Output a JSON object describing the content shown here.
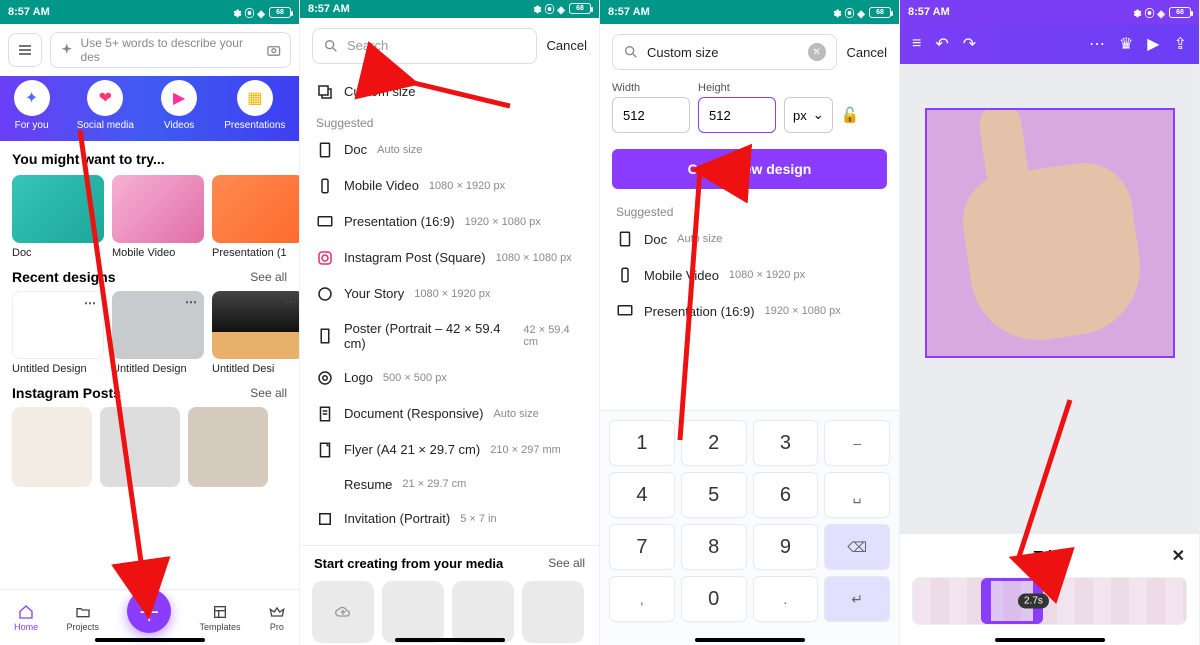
{
  "status": {
    "time": "8:57 AM",
    "battery": "68",
    "icons": "✕ ◁ ✕ ✕"
  },
  "col1": {
    "search_placeholder": "Use 5+ words to describe your des",
    "chips": [
      {
        "label": "For you",
        "glyph": "✦",
        "color": "#4f6ef5"
      },
      {
        "label": "Social media",
        "glyph": "❤",
        "color": "#ff3b6b"
      },
      {
        "label": "Videos",
        "glyph": "▶",
        "color": "#ff2fa0"
      },
      {
        "label": "Presentations",
        "glyph": "▦",
        "color": "#ffb300"
      }
    ],
    "try_heading": "You might want to try...",
    "try_items": [
      {
        "label": "Doc"
      },
      {
        "label": "Mobile Video"
      },
      {
        "label": "Presentation (1"
      }
    ],
    "recent_heading": "Recent designs",
    "see_all": "See all",
    "recent_items": [
      {
        "label": "Untitled Design"
      },
      {
        "label": "Untitled Design"
      },
      {
        "label": "Untitled Desi"
      }
    ],
    "ig_heading": "Instagram Posts",
    "nav": {
      "home": "Home",
      "projects": "Projects",
      "templates": "Templates",
      "pro": "Pro"
    }
  },
  "col2": {
    "search_placeholder": "Search",
    "cancel": "Cancel",
    "custom_size": "Custom size",
    "suggested": "Suggested",
    "items": [
      {
        "name": "Doc",
        "dim": "Auto size"
      },
      {
        "name": "Mobile Video",
        "dim": "1080 × 1920 px"
      },
      {
        "name": "Presentation (16:9)",
        "dim": "1920 × 1080 px"
      },
      {
        "name": "Instagram Post (Square)",
        "dim": "1080 × 1080 px"
      },
      {
        "name": "Your Story",
        "dim": "1080 × 1920 px"
      },
      {
        "name": "Poster (Portrait – 42 × 59.4 cm)",
        "dim": "42 × 59.4 cm"
      },
      {
        "name": "Logo",
        "dim": "500 × 500 px"
      },
      {
        "name": "Document (Responsive)",
        "dim": "Auto size"
      },
      {
        "name": "Flyer (A4 21 × 29.7 cm)",
        "dim": "210 × 297 mm"
      },
      {
        "name": "Resume",
        "dim": "21 × 29.7 cm"
      },
      {
        "name": "Invitation (Portrait)",
        "dim": "5 × 7 in"
      }
    ],
    "media_heading": "Start creating from your media",
    "see_all": "See all"
  },
  "col3": {
    "search_value": "Custom size",
    "cancel": "Cancel",
    "width_label": "Width",
    "height_label": "Height",
    "width_value": "512",
    "height_value": "512",
    "unit": "px",
    "unit_caret": "⌄",
    "cta": "Create new design",
    "suggested": "Suggested",
    "items": [
      {
        "name": "Doc",
        "dim": "Auto size"
      },
      {
        "name": "Mobile Video",
        "dim": "1080 × 1920 px"
      },
      {
        "name": "Presentation (16:9)",
        "dim": "1920 × 1080 px"
      }
    ],
    "keypad": {
      "rows": [
        [
          "1",
          "2",
          "3",
          "–"
        ],
        [
          "4",
          "5",
          "6",
          "␣"
        ],
        [
          "7",
          "8",
          "9",
          "⌫"
        ],
        [
          ",",
          "0",
          ".",
          "↵"
        ]
      ]
    }
  },
  "col4": {
    "trim": "Trim",
    "duration": "2.7s"
  }
}
